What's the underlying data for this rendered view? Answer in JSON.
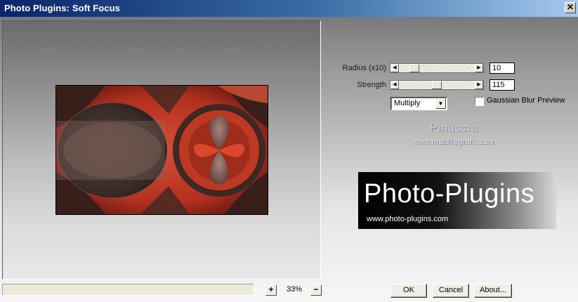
{
  "window": {
    "title": "Photo Plugins: Soft Focus",
    "close_glyph": "✕"
  },
  "params": {
    "radius": {
      "label": "Radius (x10)",
      "value": "10",
      "fraction": 0.15
    },
    "strength": {
      "label": "Strength",
      "value": "115",
      "fraction": 0.5
    },
    "blend_mode": {
      "selected": "Multiply"
    },
    "gaussian_preview": {
      "label": "Gaussian Blur Preview",
      "checked": false
    }
  },
  "watermark": {
    "name": "Pinuccia",
    "url": "www.maidiregrafica.eu"
  },
  "logo": {
    "title": "Photo-Plugins",
    "url": "www.photo-plugins.com"
  },
  "zoom": {
    "plus": "+",
    "minus": "−",
    "level": "33%"
  },
  "buttons": {
    "ok": "OK",
    "cancel": "Cancel",
    "about": "About..."
  },
  "icons": {
    "close": "close-icon",
    "dropdown": "chevron-down-icon",
    "arrow_left": "arrow-left-icon",
    "arrow_right": "arrow-right-icon"
  },
  "colors": {
    "title_start": "#0a246a",
    "title_end": "#a6caf0",
    "image_red": "#c0392b",
    "image_dark": "#3a2c28"
  }
}
